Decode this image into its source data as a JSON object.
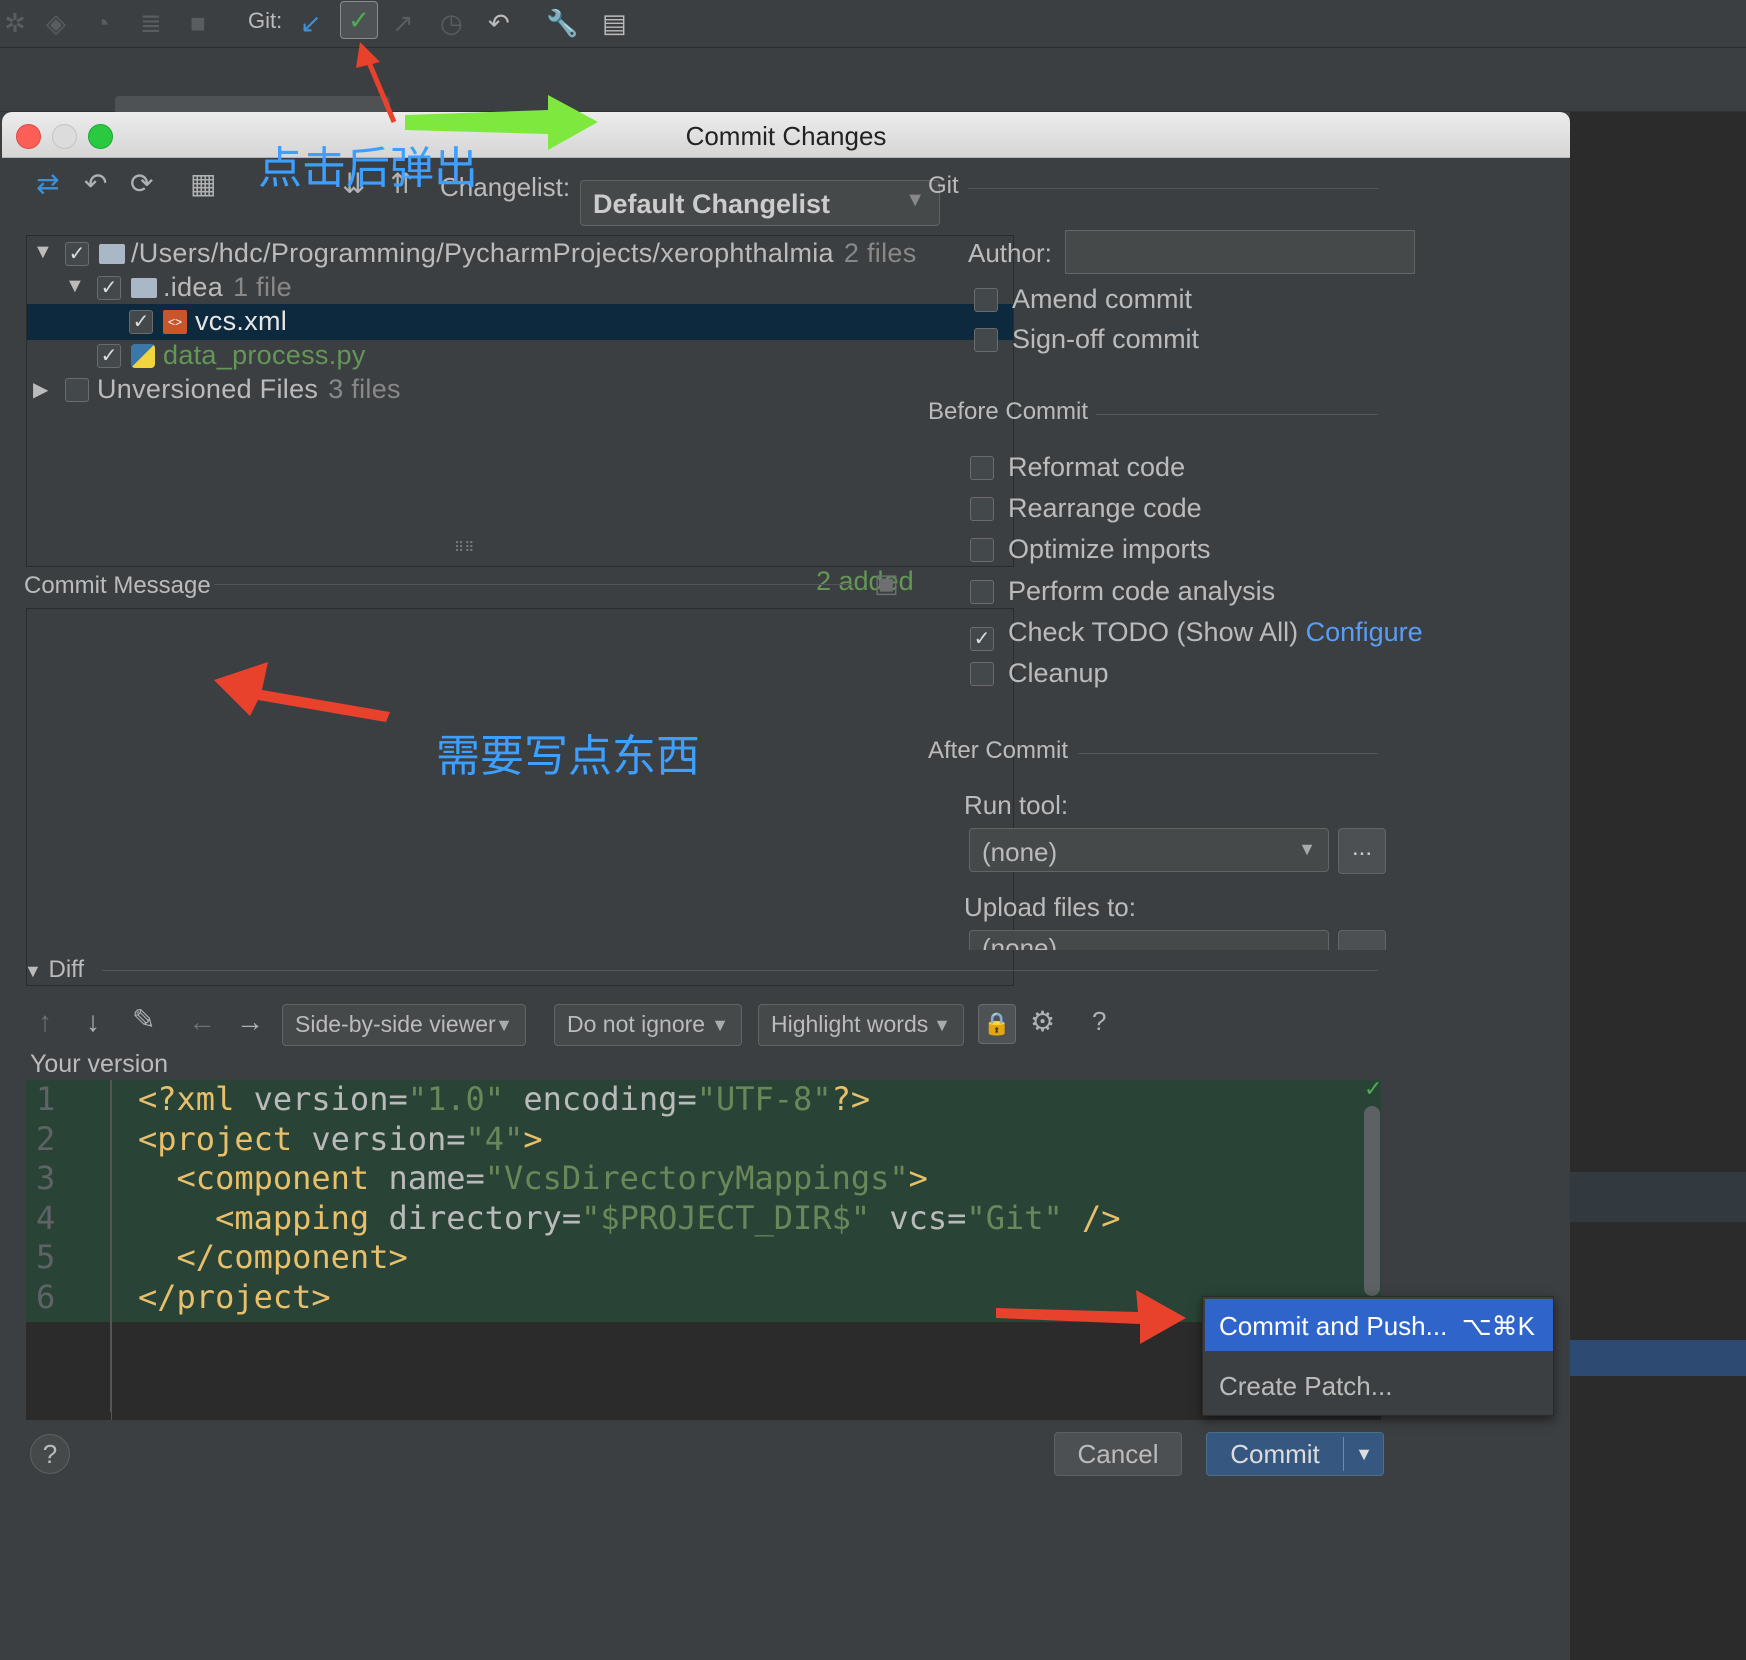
{
  "ide_toolbar": {
    "git_label": "Git:"
  },
  "dialog": {
    "title": "Commit Changes",
    "changelist_label": "Changelist:",
    "changelist_value": "Default Changelist",
    "tree": [
      {
        "name": "/Users/hdc/Programming/PycharmProjects/xerophthalmia",
        "count": "2 files"
      },
      {
        "name": ".idea",
        "count": "1 file"
      },
      {
        "name": "vcs.xml",
        "count": ""
      },
      {
        "name": "data_process.py",
        "count": ""
      },
      {
        "name": "Unversioned Files",
        "count": "3 files"
      }
    ],
    "added_text": "2 added",
    "commit_message_label": "Commit Message",
    "right": {
      "git_section": "Git",
      "author_label": "Author:",
      "amend_commit": "Amend commit",
      "signoff_commit": "Sign-off commit",
      "before_commit_section": "Before Commit",
      "before_options": [
        "Reformat code",
        "Rearrange code",
        "Optimize imports",
        "Perform code analysis",
        "Check TODO (Show All)",
        "Cleanup"
      ],
      "configure_link": "Configure",
      "after_commit_section": "After Commit",
      "run_tool_label": "Run tool:",
      "run_tool_value": "(none)",
      "upload_label": "Upload files to:",
      "upload_value": "(none)",
      "more_button": "..."
    },
    "diff": {
      "label": "Diff",
      "viewer": "Side-by-side viewer",
      "ignore": "Do not ignore",
      "highlight": "Highlight words",
      "help": "?",
      "your_version": "Your version",
      "line_numbers": [
        "1",
        "2",
        "3",
        "4",
        "5",
        "6"
      ]
    },
    "popup": {
      "commit_push": "Commit and Push...",
      "commit_push_shortcut": "⌥⌘K",
      "create_patch": "Create Patch..."
    },
    "cancel": "Cancel",
    "commit": "Commit",
    "help": "?"
  },
  "annotations": {
    "popup_note": "点击后弹出",
    "write_note": "需要写点东西"
  },
  "colors": {
    "accent_blue": "#2f65ca",
    "added_green": "#629755",
    "annotation_blue": "#3d9fff",
    "arrow_red": "#e8412c",
    "arrow_green": "#7ee83f"
  }
}
